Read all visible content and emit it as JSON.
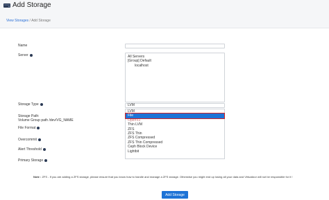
{
  "header": {
    "title": "Add Storage",
    "icon": "hard-drive-icon"
  },
  "breadcrumb": {
    "link": "View Storages",
    "separator": "/",
    "current": "Add Storage"
  },
  "form": {
    "name_label": "Name",
    "server_label": "Server",
    "server_options": [
      "All Servers",
      "[Group] Default",
      "localhost"
    ],
    "storage_type_label": "Storage Type",
    "storage_type_value": "LVM",
    "storage_path_label": "Storage Path:",
    "storage_path_hint": "Volume Group path /dev/VG_NAME",
    "file_format_label": "File Format",
    "overcommit_label": "Overcommit",
    "alert_threshold_label": "Alert Threshold",
    "primary_storage_label": "Primary Storage"
  },
  "dropdown": {
    "options": [
      "LVM",
      "File",
      "OpenVZ",
      "Thin LVM",
      "ZFS",
      "ZFS Thin",
      "ZFS Compressed",
      "ZFS Thin Compressed",
      "Ceph Block Device",
      "Lightbit"
    ],
    "selected": "File"
  },
  "note": {
    "prefix": "Note :",
    "text": "ZFS - If you are adding a ZFS storage, please ensure that you know how to handle and manage a ZFS storage. Otherwise you might end up losing all your data and Virtualizor will not be responsible for it !"
  },
  "submit_label": "Add Storage",
  "colors": {
    "accent": "#1e73d6",
    "highlight_border": "#d72222"
  }
}
